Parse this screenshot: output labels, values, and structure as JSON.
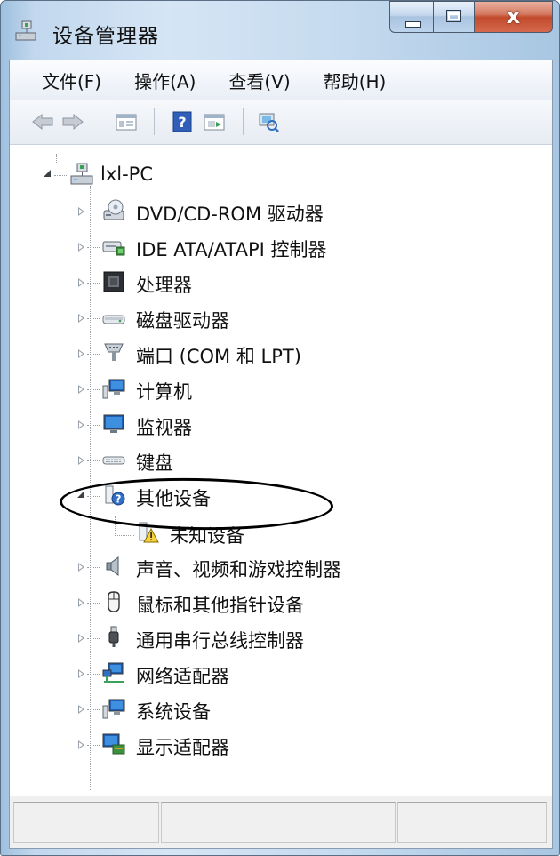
{
  "window": {
    "title": "设备管理器"
  },
  "menu": [
    {
      "label": "文件(F)"
    },
    {
      "label": "操作(A)"
    },
    {
      "label": "查看(V)"
    },
    {
      "label": "帮助(H)"
    }
  ],
  "toolbar": [
    "back-arrow-icon",
    "forward-arrow-icon",
    "properties-icon",
    "help-icon",
    "show-hidden-icon",
    "scan-hardware-icon"
  ],
  "tree": {
    "root": "lxl-PC",
    "categories": [
      {
        "label": "DVD/CD-ROM 驱动器",
        "icon": "dvd-drive-icon",
        "expanded": false
      },
      {
        "label": "IDE ATA/ATAPI 控制器",
        "icon": "ide-controller-icon",
        "expanded": false
      },
      {
        "label": "处理器",
        "icon": "processor-icon",
        "expanded": false
      },
      {
        "label": "磁盘驱动器",
        "icon": "disk-drive-icon",
        "expanded": false
      },
      {
        "label": "端口 (COM 和 LPT)",
        "icon": "port-icon",
        "expanded": false
      },
      {
        "label": "计算机",
        "icon": "computer-icon",
        "expanded": false
      },
      {
        "label": "监视器",
        "icon": "monitor-icon",
        "expanded": false
      },
      {
        "label": "键盘",
        "icon": "keyboard-icon",
        "expanded": false
      },
      {
        "label": "其他设备",
        "icon": "other-devices-icon",
        "expanded": true,
        "children": [
          {
            "label": "未知设备",
            "icon": "unknown-device-warning-icon"
          }
        ]
      },
      {
        "label": "声音、视频和游戏控制器",
        "icon": "speaker-icon",
        "expanded": false
      },
      {
        "label": "鼠标和其他指针设备",
        "icon": "mouse-icon",
        "expanded": false
      },
      {
        "label": "通用串行总线控制器",
        "icon": "usb-icon",
        "expanded": false
      },
      {
        "label": "网络适配器",
        "icon": "network-adapter-icon",
        "expanded": false
      },
      {
        "label": "系统设备",
        "icon": "system-devices-icon",
        "expanded": false
      },
      {
        "label": "显示适配器",
        "icon": "display-adapter-icon",
        "expanded": false
      }
    ]
  },
  "colors": {
    "accent": "#c24a2c",
    "frame": "#c6dbef"
  }
}
